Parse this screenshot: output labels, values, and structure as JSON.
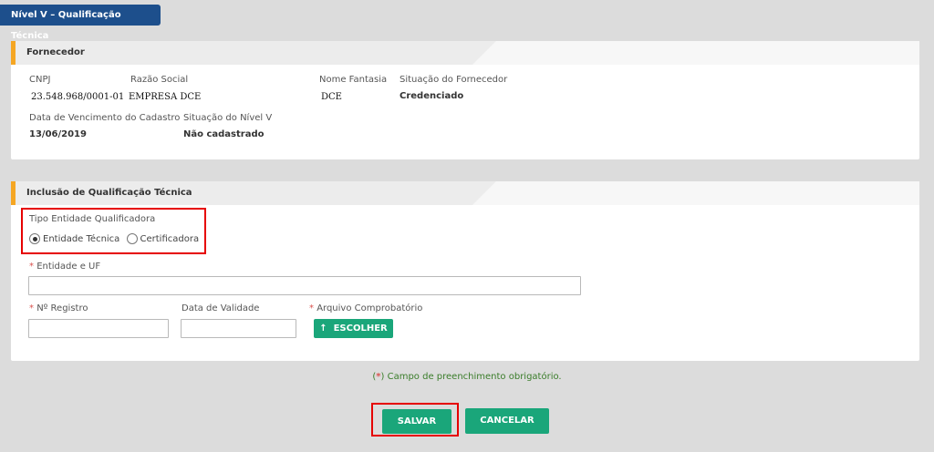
{
  "header": {
    "title": "Nível V – Qualificação Técnica"
  },
  "fornecedor": {
    "section_title": "Fornecedor",
    "cnpj_label": "CNPJ",
    "cnpj_value": "23.548.968/0001-01",
    "razao_label": "Razão Social",
    "razao_value": "EMPRESA DCE",
    "fantasia_label": "Nome Fantasia",
    "fantasia_value": "DCE",
    "situacao_label": "Situação do Fornecedor",
    "situacao_value": "Credenciado",
    "vencimento_label": "Data de Vencimento do Cadastro",
    "vencimento_value": "13/06/2019",
    "nivel_label": "Situação do Nível V",
    "nivel_value": "Não cadastrado"
  },
  "inclusao": {
    "section_title": "Inclusão de Qualificação Técnica",
    "tipo_label": "Tipo Entidade Qualificadora",
    "radio_options": [
      "Entidade Técnica",
      "Certificadora"
    ],
    "radio_selected": "Entidade Técnica",
    "entidade_label": "Entidade e UF",
    "entidade_value": "",
    "registro_label": "Nº Registro",
    "registro_value": "",
    "validade_label": "Data de Validade",
    "validade_value": "",
    "arquivo_label": "Arquivo Comprobatório",
    "escolher_label": "ESCOLHER",
    "required_mark": "*"
  },
  "footer": {
    "required_note_mark": "*",
    "required_note_text": "Campo de preenchimento obrigatório.",
    "save_label": "SALVAR",
    "cancel_label": "CANCELAR"
  },
  "colors": {
    "header_blue": "#1d4f8c",
    "accent_orange": "#f5a623",
    "button_green": "#1aa67a",
    "highlight_red": "#e60000"
  }
}
